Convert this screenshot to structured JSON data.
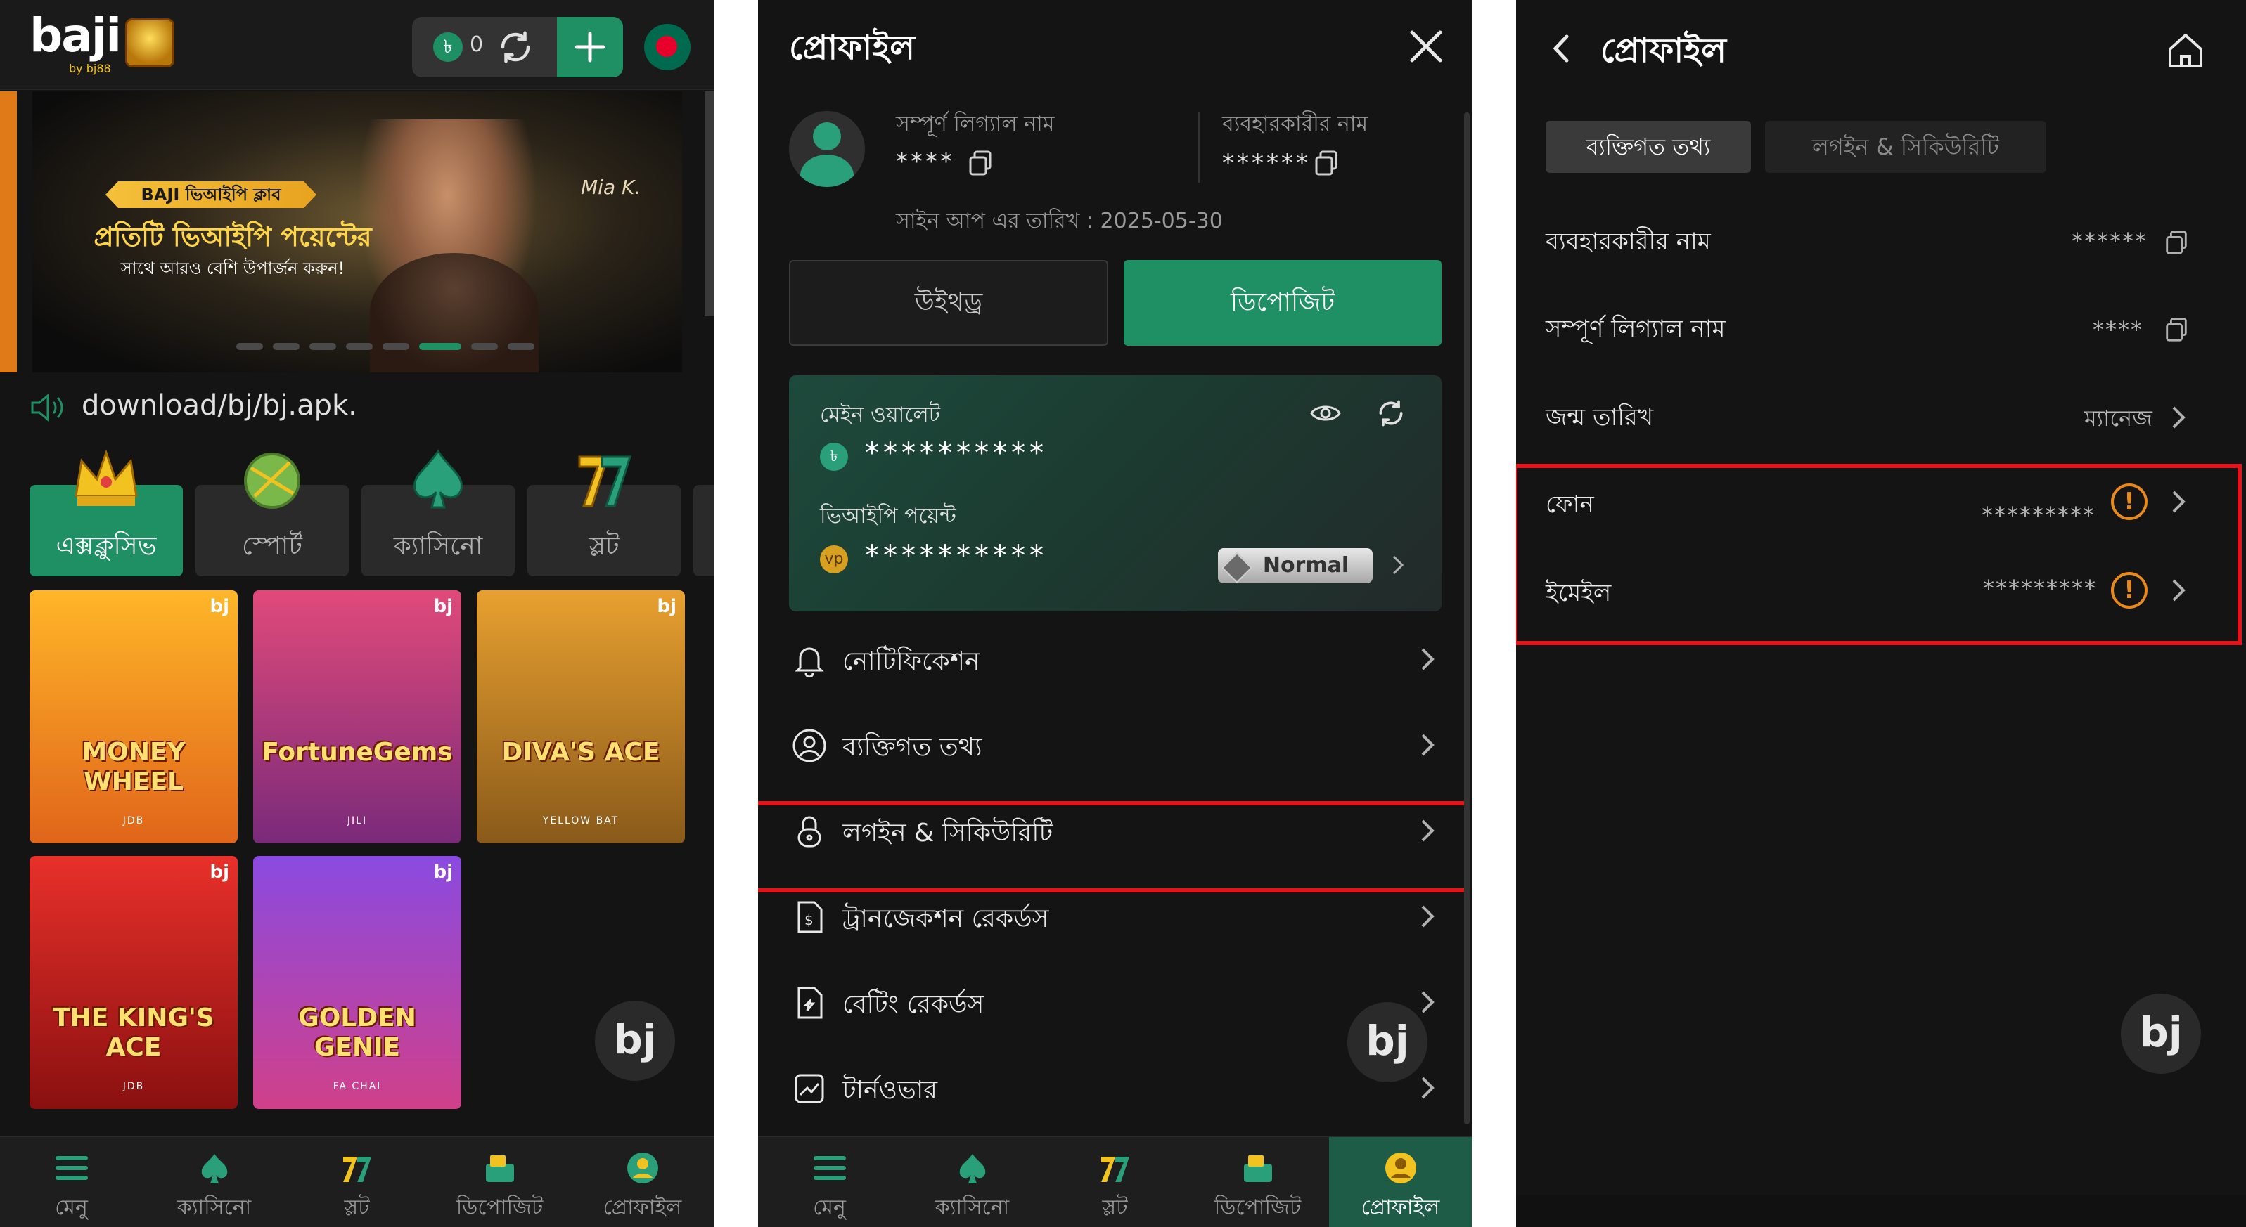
{
  "panel1": {
    "logo": "baji",
    "logo_sub": "by bj88",
    "wallet_amount": "0",
    "currency_symbol": "৳",
    "banner": {
      "tag": "BAJI ভিআইপি ক্লাব",
      "title": "প্রতিটি ভিআইপি পয়েন্টের",
      "subtitle": "সাথে আরও বেশি উপার্জন করুন!",
      "signature": "Mia K."
    },
    "announcement": "download/bj/bj.apk.",
    "categories": [
      {
        "label": "এক্সক্লুসিভ",
        "icon": "crown-icon",
        "active": true
      },
      {
        "label": "স্পোর্ট",
        "icon": "ball-icon",
        "active": false
      },
      {
        "label": "ক্যাসিনো",
        "icon": "spade-icon",
        "active": false
      },
      {
        "label": "স্লট",
        "icon": "seven-icon",
        "active": false
      }
    ],
    "games": [
      {
        "title": "MONEY WHEEL",
        "provider": "JDB",
        "brand": "bj",
        "colors": [
          "#ffb628",
          "#e0651a"
        ]
      },
      {
        "title": "FortuneGems",
        "provider": "JILI",
        "brand": "bj",
        "colors": [
          "#e04a7a",
          "#7a2a7a"
        ]
      },
      {
        "title": "DIVA'S ACE",
        "provider": "YELLOW BAT",
        "brand": "bj",
        "colors": [
          "#e8a030",
          "#8a5a1a"
        ]
      },
      {
        "title": "THE KING'S ACE",
        "provider": "JDB",
        "brand": "bj",
        "colors": [
          "#e8302a",
          "#8a1010"
        ]
      },
      {
        "title": "GOLDEN GENIE",
        "provider": "FA CHAI",
        "brand": "bj",
        "colors": [
          "#8a4ae0",
          "#d0408a"
        ]
      }
    ],
    "fab": "bj",
    "bottom_nav": [
      {
        "label": "মেনু",
        "icon": "menu-icon",
        "active": false
      },
      {
        "label": "ক্যাসিনো",
        "icon": "casino-icon",
        "active": false
      },
      {
        "label": "স্লট",
        "icon": "slot-icon",
        "active": false
      },
      {
        "label": "ডিপোজিট",
        "icon": "deposit-icon",
        "active": false
      },
      {
        "label": "প্রোফাইল",
        "icon": "profile-icon",
        "active": false
      }
    ]
  },
  "panel2": {
    "title": "প্রোফাইল",
    "full_name_label": "সম্পূর্ণ লিগ্যাল নাম",
    "full_name_value": "****",
    "username_label": "ব্যবহারকারীর নাম",
    "username_value": "******",
    "signup_date": "সাইন আপ এর তারিখ : 2025-05-30",
    "withdraw_label": "উইথড্র",
    "deposit_label": "ডিপোজিট",
    "main_wallet_label": "মেইন ওয়ালেট",
    "main_wallet_value": "**********",
    "vip_points_label": "ভিআইপি পয়েন্ট",
    "vip_points_value": "**********",
    "vip_level": "Normal",
    "menu": [
      {
        "label": "নোটিফিকেশন",
        "icon": "bell-icon"
      },
      {
        "label": "ব্যক্তিগত তথ্য",
        "icon": "user-circle-icon"
      },
      {
        "label": "লগইন & সিকিউরিটি",
        "icon": "lock-icon",
        "highlighted": true
      },
      {
        "label": "ট্রানজেকশন রেকর্ডস",
        "icon": "transaction-icon"
      },
      {
        "label": "বেটিং রেকর্ডস",
        "icon": "betting-icon"
      },
      {
        "label": "টার্নওভার",
        "icon": "turnover-icon"
      }
    ],
    "fab": "bj",
    "bottom_nav": [
      {
        "label": "মেনু",
        "icon": "menu-icon",
        "active": false
      },
      {
        "label": "ক্যাসিনো",
        "icon": "casino-icon",
        "active": false
      },
      {
        "label": "স্লট",
        "icon": "slot-icon",
        "active": false
      },
      {
        "label": "ডিপোজিট",
        "icon": "deposit-icon",
        "active": false
      },
      {
        "label": "প্রোফাইল",
        "icon": "profile-icon",
        "active": true
      }
    ]
  },
  "panel3": {
    "title": "প্রোফাইল",
    "tabs": [
      {
        "label": "ব্যক্তিগত তথ্য",
        "active": true
      },
      {
        "label": "লগইন & সিকিউরিটি",
        "active": false
      }
    ],
    "rows": [
      {
        "label": "ব্যবহারকারীর নাম",
        "value": "******",
        "action": "copy"
      },
      {
        "label": "সম্পূর্ণ লিগ্যাল নাম",
        "value": "****",
        "action": "copy"
      },
      {
        "label": "জন্ম তারিখ",
        "value": "ম্যানেজ",
        "action": "chevron"
      },
      {
        "label": "ফোন",
        "value": "*********",
        "action": "warning"
      },
      {
        "label": "ইমেইল",
        "value": "*********",
        "action": "warning"
      }
    ],
    "fab": "bj"
  },
  "colors": {
    "accent": "#1f8f64",
    "highlight": "#e4141c",
    "warning": "#e8891c",
    "background": "#141414"
  }
}
